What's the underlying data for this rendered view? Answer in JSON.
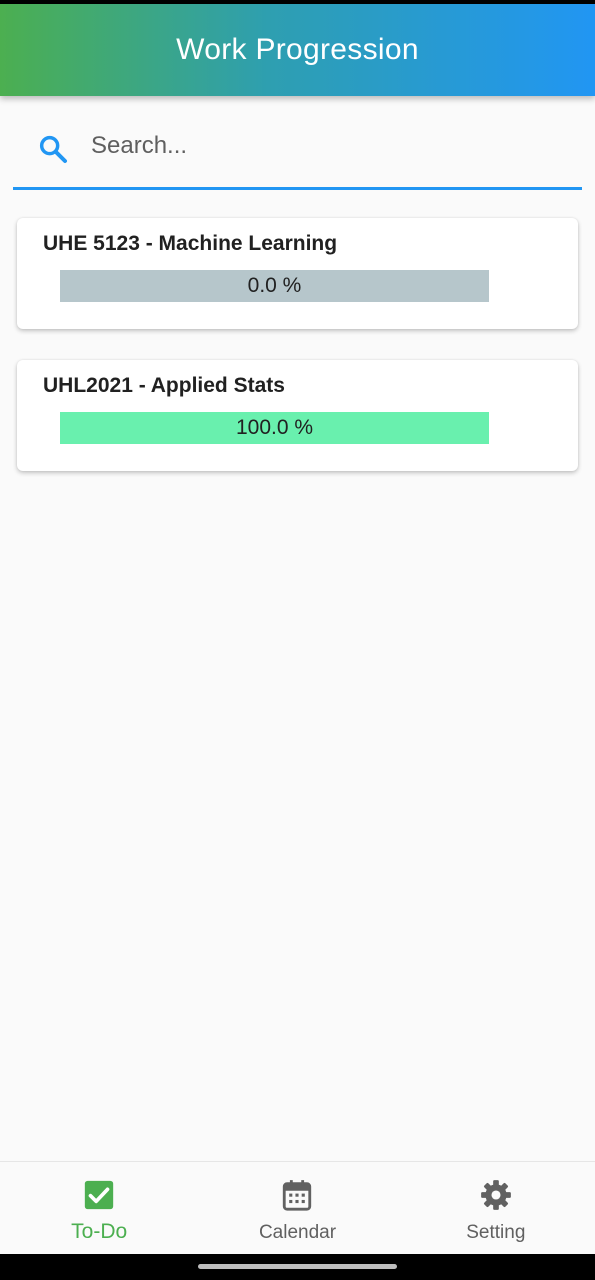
{
  "app": {
    "title": "Work Progression"
  },
  "search": {
    "placeholder": "Search...",
    "value": "",
    "icon": "search-icon"
  },
  "courses": [
    {
      "title": "UHE 5123 - Machine Learning",
      "progress": 0.0,
      "progress_label": "0.0 %"
    },
    {
      "title": "UHL2021 - Applied Stats",
      "progress": 100.0,
      "progress_label": "100.0 %"
    }
  ],
  "nav": {
    "items": [
      {
        "label": "To-Do",
        "icon": "checkbox-icon",
        "active": true
      },
      {
        "label": "Calendar",
        "icon": "calendar-icon",
        "active": false
      },
      {
        "label": "Setting",
        "icon": "gear-icon",
        "active": false
      }
    ]
  },
  "colors": {
    "header_gradient_start": "#4caf50",
    "header_gradient_end": "#2196f3",
    "accent": "#2196f3",
    "progress_track": "#b6c6cb",
    "progress_fill": "#69f0ae",
    "nav_active": "#4caf50",
    "nav_inactive": "#606060"
  }
}
